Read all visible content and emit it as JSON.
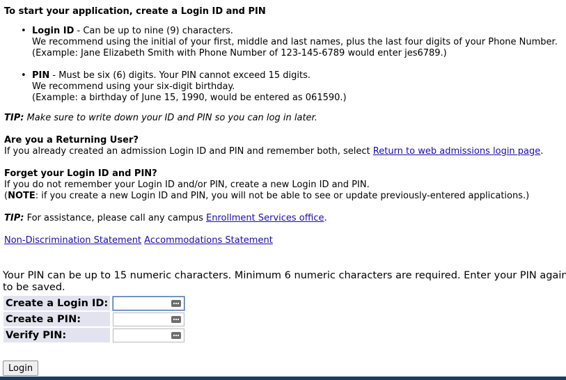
{
  "intro": {
    "heading": "To start your application, create a Login ID and PIN"
  },
  "bullets": [
    {
      "term": "Login ID",
      "desc": " - Can be up to nine (9) characters.",
      "line2": "We recommend using the initial of your first, middle and last names, plus the last four digits of your Phone Number.",
      "line3": "(Example: Jane Elizabeth Smith with Phone Number of 123-145-6789 would enter jes6789.)"
    },
    {
      "term": "PIN",
      "desc": " - Must be six (6) digits. Your PIN cannot exceed 15 digits.",
      "line2": "We recommend using your six-digit birthday.",
      "line3": "(Example: a birthday of June 15, 1990, would be entered as 061590.)"
    }
  ],
  "tip1": {
    "label": "TIP:",
    "text": " Make sure to write down your ID and PIN so you can log in later."
  },
  "returning": {
    "title": "Are you a Returning User?",
    "text": "If you already created an admission Login ID and PIN and remember both, select ",
    "link": "Return to web admissions login page",
    "after": "."
  },
  "forget": {
    "title": "Forget your Login ID and PIN?",
    "line1": "If you do not remember your Login ID and/or PIN, create a new Login ID and PIN.",
    "note_open": "(",
    "note_label": "NOTE",
    "note_text": ": if you create a new Login ID and PIN, you will not be able to see or update previously-entered applications.)"
  },
  "tip2": {
    "label": "TIP:",
    "text": " For assistance, please call any campus ",
    "link": "Enrollment Services office",
    "after": "."
  },
  "statements": {
    "nondiscrimination": "Non-Discrimination Statement",
    "accommodations": "Accommodations Statement"
  },
  "pin_note": "Your PIN can be up to 15 numeric characters. Minimum 6 numeric characters are required. Enter your PIN again to be saved.",
  "form": {
    "login_id_label": "Create a Login ID:",
    "pin_label": "Create a PIN:",
    "verify_label": "Verify PIN:",
    "login_id_value": "",
    "pin_value": "",
    "verify_value": ""
  },
  "login_button": "Login",
  "icons": {
    "field_icon": "password-manager-key-icon"
  },
  "colors": {
    "link": "#1a0dab",
    "label_bg": "#e3e3ef",
    "bottom_bar": "#1f3a5f"
  }
}
